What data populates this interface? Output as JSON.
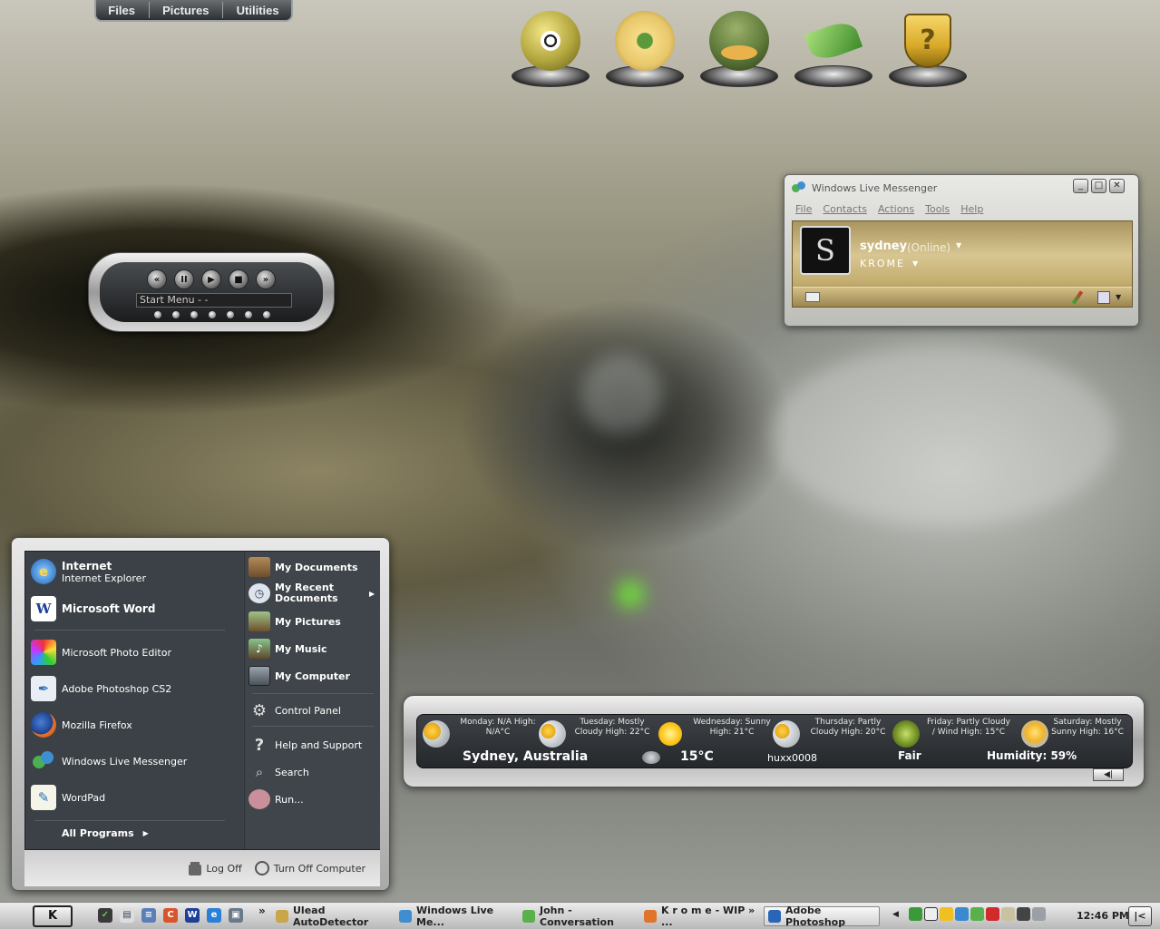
{
  "top_bar": {
    "tabs": [
      "Files",
      "Pictures",
      "Utilities"
    ]
  },
  "dock": {
    "items": [
      {
        "name": "chameleon-icon",
        "color": "#b1a53c"
      },
      {
        "name": "flower-icon",
        "color": "#e8c76a"
      },
      {
        "name": "duck-icon",
        "color": "#5f7a3a"
      },
      {
        "name": "leaf-icon",
        "color": "#5aa23c"
      },
      {
        "name": "shield-icon",
        "color": "#d9a928"
      }
    ]
  },
  "media_player": {
    "text": "Start Menu -  -",
    "buttons": [
      "rewind-icon",
      "pause-icon",
      "play-icon",
      "stop-icon",
      "forward-icon"
    ],
    "dots": 7
  },
  "messenger": {
    "title": "Windows Live Messenger",
    "menu": [
      "File",
      "Contacts",
      "Actions",
      "Tools",
      "Help"
    ],
    "name": "sydney",
    "status": "(Online)",
    "personal_message": "KROME",
    "accent": "#c4ae70"
  },
  "start_menu": {
    "pinned": [
      {
        "title": "Internet",
        "subtitle": "Internet Explorer",
        "icon": "internet-explorer-icon"
      },
      {
        "title": "Microsoft Word",
        "icon": "word-icon"
      }
    ],
    "recent": [
      {
        "label": "Microsoft Photo Editor",
        "icon": "photo-editor-icon"
      },
      {
        "label": "Adobe Photoshop CS2",
        "icon": "photoshop-icon"
      },
      {
        "label": "Mozilla Firefox",
        "icon": "firefox-icon"
      },
      {
        "label": "Windows Live Messenger",
        "icon": "messenger-icon"
      },
      {
        "label": "WordPad",
        "icon": "wordpad-icon"
      }
    ],
    "all_programs": "All Programs",
    "places": [
      {
        "label": "My Documents",
        "icon": "folder-icon"
      },
      {
        "label": "My Recent Documents",
        "icon": "recent-docs-icon"
      },
      {
        "label": "My Pictures",
        "icon": "pictures-folder-icon"
      },
      {
        "label": "My Music",
        "icon": "music-folder-icon"
      },
      {
        "label": "My Computer",
        "icon": "computer-icon"
      }
    ],
    "system": [
      {
        "label": "Control Panel",
        "icon": "gear-icon"
      },
      {
        "label": "Help and Support",
        "icon": "help-icon"
      },
      {
        "label": "Search",
        "icon": "search-icon"
      },
      {
        "label": "Run...",
        "icon": "run-icon"
      }
    ],
    "log_off": "Log Off",
    "turn_off": "Turn Off Computer"
  },
  "weather": {
    "forecast": [
      "Monday: N/A High: N/A°C",
      "Tuesday: Mostly Cloudy High: 22°C",
      "Wednesday: Sunny High: 21°C",
      "Thursday: Partly Cloudy High: 20°C",
      "Friday: Partly Cloudy / Wind High: 15°C",
      "Saturday: Mostly Sunny High: 16°C"
    ],
    "location": "Sydney, Australia",
    "temperature": "15°C",
    "user": "huxx0008",
    "condition": "Fair",
    "humidity": "Humidity: 59%"
  },
  "taskbar": {
    "start_label": "K",
    "tasks": [
      {
        "label": "Ulead AutoDetector",
        "active": false,
        "color": "#c9a64a"
      },
      {
        "label": "Windows Live Me...",
        "active": false,
        "color": "#3f8fd0"
      },
      {
        "label": "John - Conversation",
        "active": false,
        "color": "#5ab04a"
      },
      {
        "label": "K r o m e - WIP » ...",
        "active": false,
        "color": "#e0742a"
      },
      {
        "label": "Adobe Photoshop",
        "active": true,
        "color": "#2a66b8"
      }
    ],
    "clock": "12:46 PM",
    "chevron": "»"
  }
}
